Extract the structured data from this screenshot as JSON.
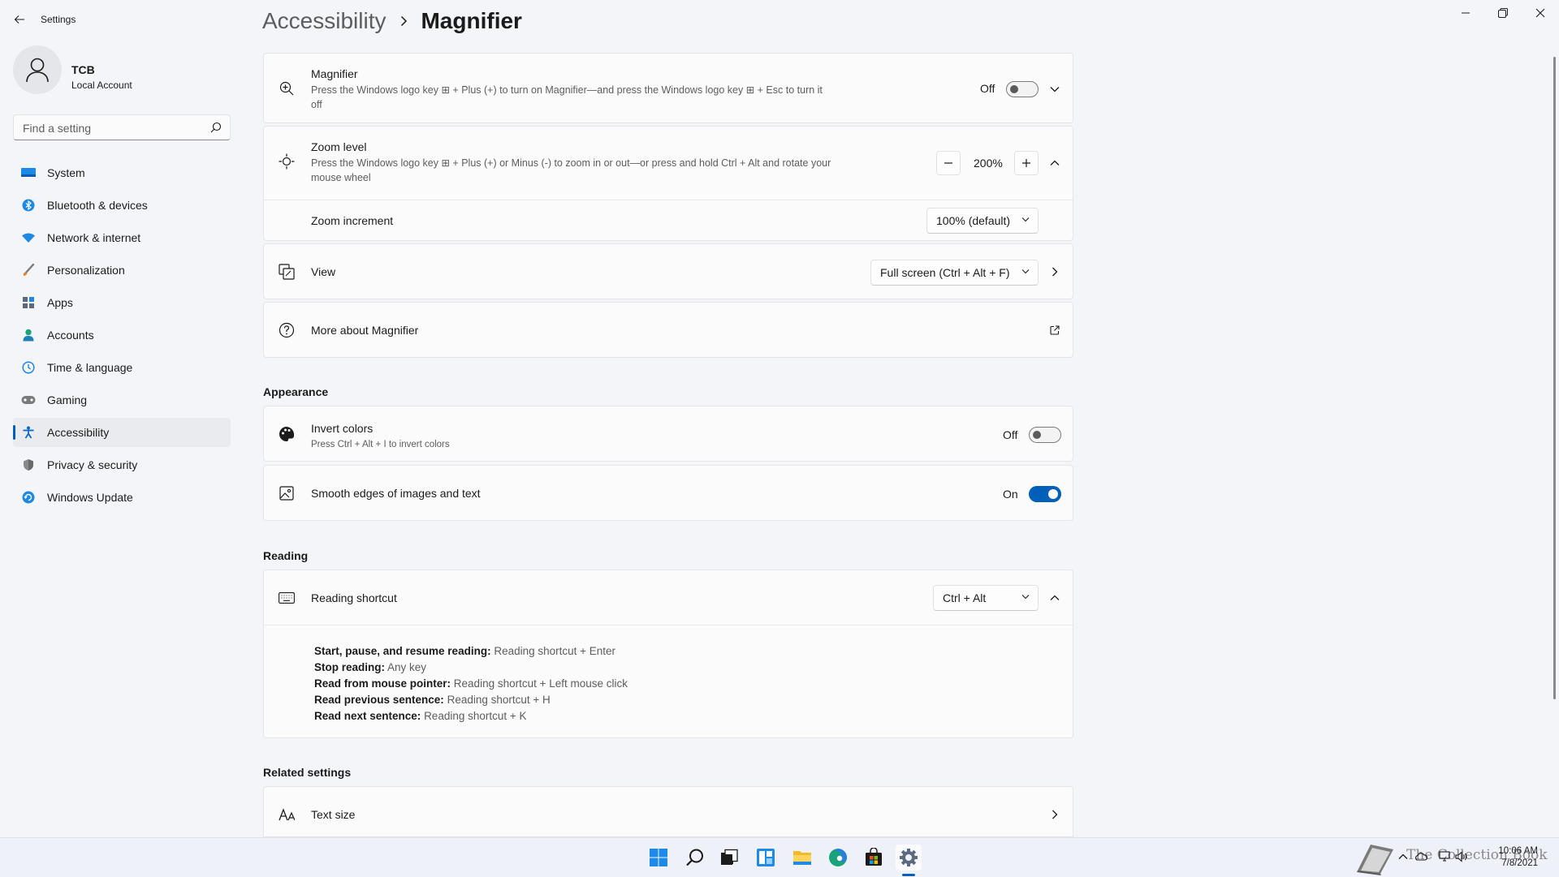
{
  "window": {
    "app_title": "Settings",
    "controls": [
      "minimize-icon",
      "restore-icon",
      "close-icon"
    ]
  },
  "profile": {
    "name": "TCB",
    "account_type": "Local Account"
  },
  "search": {
    "placeholder": "Find a setting"
  },
  "nav": {
    "items": [
      {
        "label": "System",
        "icon": "monitor-icon",
        "color": "#0078d4"
      },
      {
        "label": "Bluetooth & devices",
        "icon": "bluetooth-icon",
        "color": "#0078d4"
      },
      {
        "label": "Network & internet",
        "icon": "wifi-icon",
        "color": "#0078d4"
      },
      {
        "label": "Personalization",
        "icon": "brush-icon",
        "color": "#d27e2d"
      },
      {
        "label": "Apps",
        "icon": "apps-icon",
        "color": "#3f5f7f"
      },
      {
        "label": "Accounts",
        "icon": "person-icon",
        "color": "#1aa37b"
      },
      {
        "label": "Time & language",
        "icon": "globe-clock-icon",
        "color": "#0078d4"
      },
      {
        "label": "Gaming",
        "icon": "gamepad-icon",
        "color": "#6b6b6b"
      },
      {
        "label": "Accessibility",
        "icon": "accessibility-icon",
        "color": "#0067c0",
        "active": true
      },
      {
        "label": "Privacy & security",
        "icon": "shield-icon",
        "color": "#6b6b6b"
      },
      {
        "label": "Windows Update",
        "icon": "update-icon",
        "color": "#0078d4"
      }
    ]
  },
  "breadcrumb": {
    "parent": "Accessibility",
    "current": "Magnifier"
  },
  "magnifier": {
    "title": "Magnifier",
    "desc_line1": "Press the Windows logo key ⊞ + Plus (+) to turn on Magnifier—and press the Windows logo key ⊞ + Esc to turn it",
    "desc_line2": "off",
    "state": "Off"
  },
  "zoom_level": {
    "title": "Zoom level",
    "desc_line1": "Press the Windows logo key ⊞ + Plus (+) or Minus (-) to zoom in or out—or press and hold Ctrl + Alt and rotate your",
    "desc_line2": "mouse wheel",
    "value": "200%"
  },
  "zoom_increment": {
    "title": "Zoom increment",
    "value": "100% (default)"
  },
  "view": {
    "title": "View",
    "value": "Full screen (Ctrl + Alt + F)"
  },
  "more_about": {
    "title": "More about Magnifier"
  },
  "appearance": {
    "heading": "Appearance",
    "invert": {
      "title": "Invert colors",
      "desc": "Press Ctrl + Alt + I to invert colors",
      "state": "Off"
    },
    "smooth": {
      "title": "Smooth edges of images and text",
      "state": "On"
    }
  },
  "reading": {
    "heading": "Reading",
    "shortcut": {
      "title": "Reading shortcut",
      "value": "Ctrl + Alt"
    },
    "lines": [
      {
        "label": "Start, pause, and resume reading:",
        "value": "Reading shortcut + Enter"
      },
      {
        "label": "Stop reading:",
        "value": "Any key"
      },
      {
        "label": "Read from mouse pointer:",
        "value": "Reading shortcut + Left mouse click"
      },
      {
        "label": "Read previous sentence:",
        "value": "Reading shortcut + H"
      },
      {
        "label": "Read next sentence:",
        "value": "Reading shortcut + K"
      }
    ]
  },
  "related": {
    "heading": "Related settings",
    "text_size": "Text size"
  },
  "taskbar": {
    "icons": [
      "start-icon",
      "search-icon",
      "task-view-icon",
      "widgets-icon",
      "file-explorer-icon",
      "edge-icon",
      "store-icon",
      "settings-icon"
    ],
    "time": "10:06 AM",
    "date": "7/8/2021",
    "watermark": "The Collection Book"
  },
  "colors": {
    "accent": "#005fb8",
    "background": "#f3f5f9",
    "card": "#fbfbfc"
  }
}
